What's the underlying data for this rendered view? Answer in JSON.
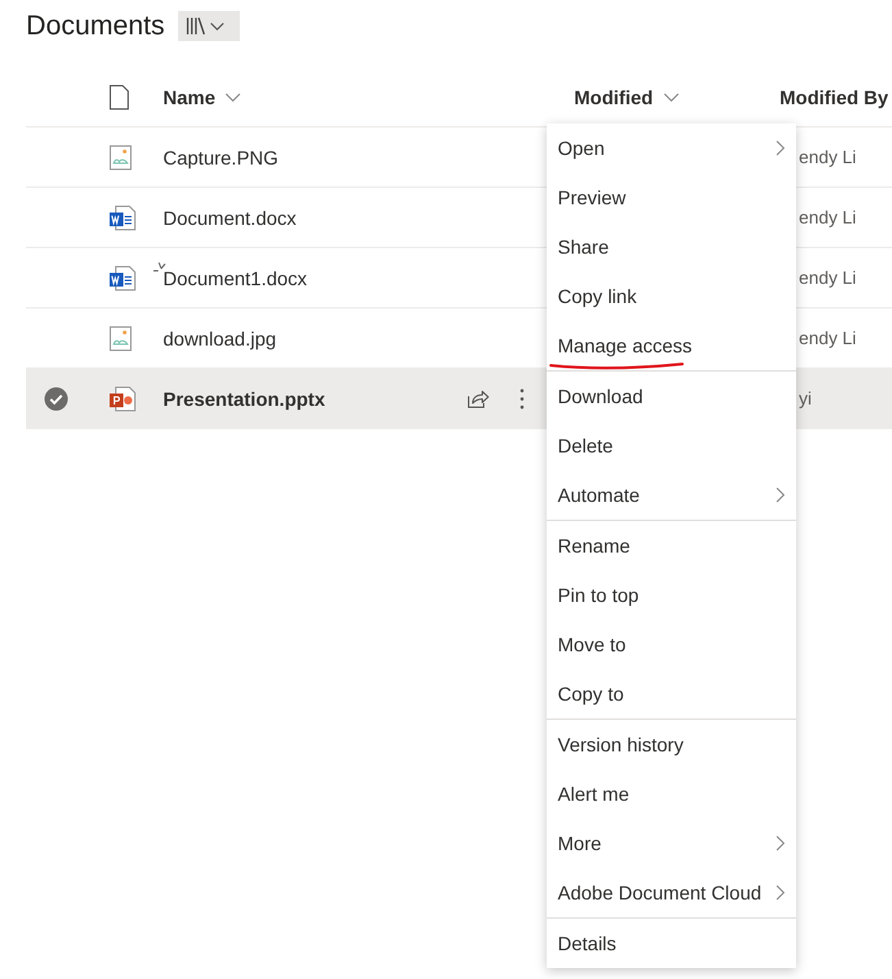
{
  "title": "Documents",
  "columns": [
    {
      "label": "Name",
      "sortable": true
    },
    {
      "label": "Modified",
      "sortable": true
    },
    {
      "label": "Modified By",
      "sortable": false
    }
  ],
  "rows": [
    {
      "name": "Capture.PNG",
      "kind": "image",
      "is_new": false,
      "selected": false,
      "modified_by": "endy Li"
    },
    {
      "name": "Document.docx",
      "kind": "word",
      "is_new": false,
      "selected": false,
      "modified_by": "endy Li"
    },
    {
      "name": "Document1.docx",
      "kind": "word",
      "is_new": true,
      "selected": false,
      "modified_by": "endy Li"
    },
    {
      "name": "download.jpg",
      "kind": "image",
      "is_new": false,
      "selected": false,
      "modified_by": "endy Li"
    },
    {
      "name": "Presentation.pptx",
      "kind": "powerpoint",
      "is_new": false,
      "selected": true,
      "modified_by": "yi"
    }
  ],
  "context_menu": {
    "groups": [
      [
        {
          "label": "Open",
          "submenu": true,
          "annotated": false
        },
        {
          "label": "Preview",
          "submenu": false,
          "annotated": false
        },
        {
          "label": "Share",
          "submenu": false,
          "annotated": false
        },
        {
          "label": "Copy link",
          "submenu": false,
          "annotated": false
        },
        {
          "label": "Manage access",
          "submenu": false,
          "annotated": true
        }
      ],
      [
        {
          "label": "Download",
          "submenu": false,
          "annotated": false
        },
        {
          "label": "Delete",
          "submenu": false,
          "annotated": false
        },
        {
          "label": "Automate",
          "submenu": true,
          "annotated": false
        }
      ],
      [
        {
          "label": "Rename",
          "submenu": false,
          "annotated": false
        },
        {
          "label": "Pin to top",
          "submenu": false,
          "annotated": false
        },
        {
          "label": "Move to",
          "submenu": false,
          "annotated": false
        },
        {
          "label": "Copy to",
          "submenu": false,
          "annotated": false
        }
      ],
      [
        {
          "label": "Version history",
          "submenu": false,
          "annotated": false
        },
        {
          "label": "Alert me",
          "submenu": false,
          "annotated": false
        },
        {
          "label": "More",
          "submenu": true,
          "annotated": false
        },
        {
          "label": "Adobe Document Cloud",
          "submenu": true,
          "annotated": false
        }
      ],
      [
        {
          "label": "Details",
          "submenu": false,
          "annotated": false
        }
      ]
    ]
  }
}
